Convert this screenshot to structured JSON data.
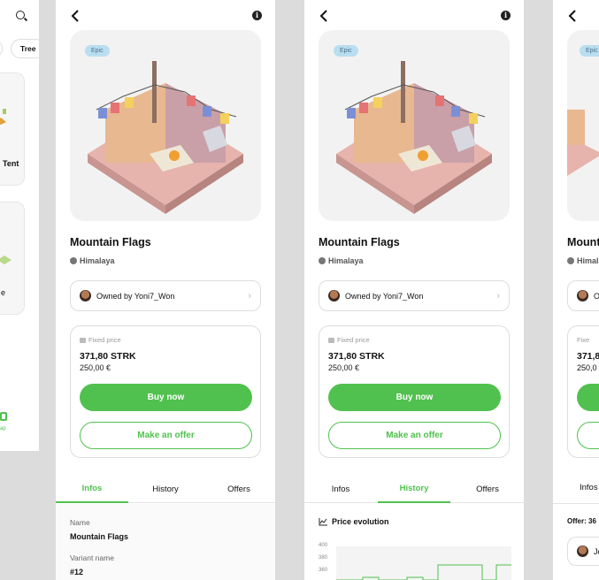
{
  "left_screen": {
    "chip_label": "Tree",
    "item_label": "Tent",
    "item_label_2": "e",
    "nav_label": "ap"
  },
  "product": {
    "badge": "Epic",
    "title": "Mountain Flags",
    "location": "Himalaya",
    "owner": "Owned by Yoni7_Won",
    "price_type": "Fixed price",
    "price_strk": "371,80 STRK",
    "price_eur": "250,00 €",
    "buy_label": "Buy now",
    "offer_label": "Make an offer"
  },
  "tabs": [
    "Infos",
    "History",
    "Offers"
  ],
  "infos": {
    "name_label": "Name",
    "name_value": "Mountain Flags",
    "variant_label": "Variant name",
    "variant_value": "#12"
  },
  "history": {
    "section_title": "Price evolution",
    "y_ticks": [
      "400",
      "380",
      "360"
    ]
  },
  "offers_screen": {
    "title_partial": "Mount",
    "location_partial": "Himal",
    "owner_partial": "O",
    "price_type_partial": "Fixe",
    "price_strk_partial": "371,8",
    "price_eur_partial": "250,0",
    "offer_partial": "Offer: 36",
    "offer_user_partial": "Je",
    "tab_partial": "Infos"
  },
  "colors": {
    "accent": "#50c14e",
    "badge": "#b9def0"
  }
}
